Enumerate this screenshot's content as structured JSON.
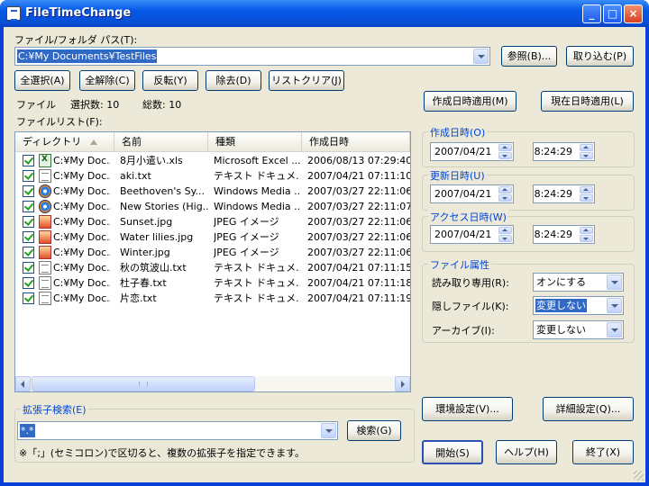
{
  "window": {
    "title": "FileTimeChange"
  },
  "path": {
    "label": "ファイル/フォルダ パス(T):",
    "value": "C:¥My Documents¥TestFiles"
  },
  "top_buttons": {
    "browse": "参照(B)...",
    "import": "取り込む(P)"
  },
  "selection_buttons": {
    "select_all": "全選択(A)",
    "deselect_all": "全解除(C)",
    "invert": "反転(Y)",
    "remove": "除去(D)",
    "list_clear": "リストクリア(J)"
  },
  "stats": {
    "files_label": "ファイル",
    "selected": "選択数: 10",
    "total": "総数: 10"
  },
  "apply_buttons": {
    "created_apply": "作成日時適用(M)",
    "now_apply": "現在日時適用(L)"
  },
  "file_list": {
    "label": "ファイルリスト(F):",
    "columns": [
      "ディレクトリ",
      "名前",
      "種類",
      "作成日時"
    ],
    "rows": [
      {
        "dir": "C:¥My Doc...",
        "name": "8月小遣い.xls",
        "type": "Microsoft Excel ...",
        "created": "2006/08/13 07:29:40",
        "icon": "excel-file-icon"
      },
      {
        "dir": "C:¥My Doc...",
        "name": "aki.txt",
        "type": "テキスト ドキュメ...",
        "created": "2007/04/21 07:11:10",
        "icon": "text-file-icon"
      },
      {
        "dir": "C:¥My Doc...",
        "name": "Beethoven's Sy...",
        "type": "Windows Media ...",
        "created": "2007/03/27 22:11:06",
        "icon": "media-file-icon"
      },
      {
        "dir": "C:¥My Doc...",
        "name": "New Stories (Hig...",
        "type": "Windows Media ...",
        "created": "2007/03/27 22:11:07",
        "icon": "media-file-icon"
      },
      {
        "dir": "C:¥My Doc...",
        "name": "Sunset.jpg",
        "type": "JPEG イメージ",
        "created": "2007/03/27 22:11:06",
        "icon": "jpeg-file-icon"
      },
      {
        "dir": "C:¥My Doc...",
        "name": "Water lilies.jpg",
        "type": "JPEG イメージ",
        "created": "2007/03/27 22:11:06",
        "icon": "jpeg-file-icon"
      },
      {
        "dir": "C:¥My Doc...",
        "name": "Winter.jpg",
        "type": "JPEG イメージ",
        "created": "2007/03/27 22:11:06",
        "icon": "jpeg-file-icon"
      },
      {
        "dir": "C:¥My Doc...",
        "name": "秋の筑波山.txt",
        "type": "テキスト ドキュメ...",
        "created": "2007/04/21 07:11:15",
        "icon": "text-file-icon"
      },
      {
        "dir": "C:¥My Doc...",
        "name": "杜子春.txt",
        "type": "テキスト ドキュメ...",
        "created": "2007/04/21 07:11:18",
        "icon": "text-file-icon"
      },
      {
        "dir": "C:¥My Doc...",
        "name": "片恋.txt",
        "type": "テキスト ドキュメ...",
        "created": "2007/04/21 07:11:19",
        "icon": "text-file-icon"
      }
    ]
  },
  "created_time": {
    "label": "作成日時(O)",
    "date": "2007/04/21",
    "time": "8:24:29"
  },
  "updated_time": {
    "label": "更新日時(U)",
    "date": "2007/04/21",
    "time": "8:24:29"
  },
  "access_time": {
    "label": "アクセス日時(W)",
    "date": "2007/04/21",
    "time": "8:24:29"
  },
  "attributes": {
    "label": "ファイル属性",
    "readonly_label": "読み取り専用(R):",
    "readonly_value": "オンにする",
    "hidden_label": "隠しファイル(K):",
    "hidden_value": "変更しない",
    "archive_label": "アーカイブ(I):",
    "archive_value": "変更しない"
  },
  "extension_search": {
    "label": "拡張子検索(E)",
    "value": "*.*",
    "button": "検索(G)",
    "note": "※「;」(セミコロン)で区切ると、複数の拡張子を指定できます。"
  },
  "bottom_buttons": {
    "env_settings": "環境設定(V)...",
    "detail_settings": "詳細設定(Q)...",
    "start": "開始(S)",
    "help": "ヘルプ(H)",
    "exit": "終了(X)"
  }
}
